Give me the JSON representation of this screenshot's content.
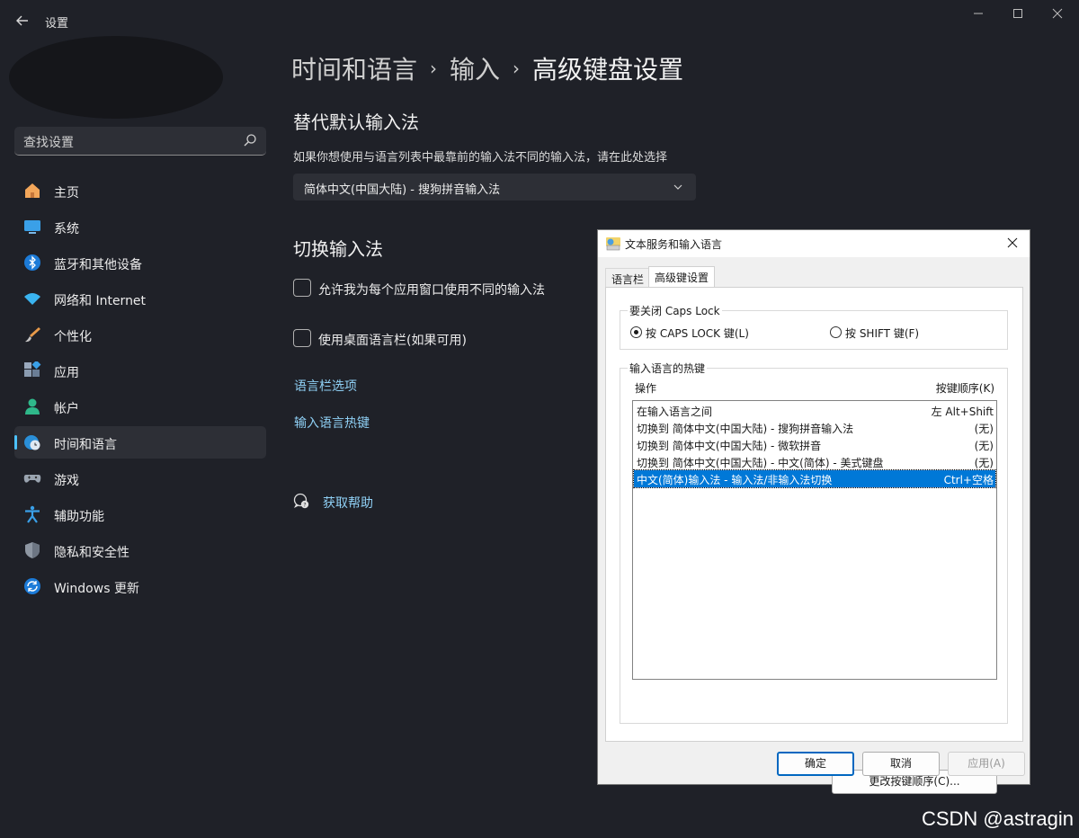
{
  "app": {
    "title": "设置",
    "back_icon": "arrow-left-icon"
  },
  "sidebar": {
    "search_placeholder": "查找设置",
    "items": [
      {
        "label": "主页",
        "icon": "home-icon",
        "active": false
      },
      {
        "label": "系统",
        "icon": "monitor-icon",
        "active": false
      },
      {
        "label": "蓝牙和其他设备",
        "icon": "bluetooth-icon",
        "active": false
      },
      {
        "label": "网络和 Internet",
        "icon": "wifi-icon",
        "active": false
      },
      {
        "label": "个性化",
        "icon": "brush-icon",
        "active": false
      },
      {
        "label": "应用",
        "icon": "apps-icon",
        "active": false
      },
      {
        "label": "帐户",
        "icon": "person-icon",
        "active": false
      },
      {
        "label": "时间和语言",
        "icon": "globe-clock-icon",
        "active": true
      },
      {
        "label": "游戏",
        "icon": "gamepad-icon",
        "active": false
      },
      {
        "label": "辅助功能",
        "icon": "accessibility-icon",
        "active": false
      },
      {
        "label": "隐私和安全性",
        "icon": "shield-icon",
        "active": false
      },
      {
        "label": "Windows 更新",
        "icon": "refresh-icon",
        "active": false
      }
    ]
  },
  "breadcrumb": {
    "part1": "时间和语言",
    "part2": "输入",
    "current": "高级键盘设置",
    "separator": "›"
  },
  "main": {
    "section1_title": "替代默认输入法",
    "section1_desc": "如果你想使用与语言列表中最靠前的输入法不同的输入法，请在此处选择",
    "dropdown_value": "简体中文(中国大陆) - 搜狗拼音输入法",
    "section2_title": "切换输入法",
    "checkbox1_label": "允许我为每个应用窗口使用不同的输入法",
    "checkbox2_label": "使用桌面语言栏(如果可用)",
    "link1": "语言栏选项",
    "link2": "输入语言热键",
    "help_link": "获取帮助"
  },
  "dialog": {
    "title": "文本服务和输入语言",
    "tabs": [
      "语言栏",
      "高级键设置"
    ],
    "active_tab": 1,
    "capslock_group": "要关闭 Caps Lock",
    "radio1": "按 CAPS LOCK 键(L)",
    "radio2": "按 SHIFT 键(F)",
    "radio_selected": 1,
    "hotkeys_group": "输入语言的热键",
    "col_action": "操作",
    "col_key": "按键顺序(K)",
    "rows": [
      {
        "action": "在输入语言之间",
        "key": "左 Alt+Shift",
        "selected": false
      },
      {
        "action": "切换到 简体中文(中国大陆) - 搜狗拼音输入法",
        "key": "(无)",
        "selected": false
      },
      {
        "action": "切换到 简体中文(中国大陆) - 微软拼音",
        "key": "(无)",
        "selected": false
      },
      {
        "action": "切换到 简体中文(中国大陆) - 中文(简体) - 美式键盘",
        "key": "(无)",
        "selected": false
      },
      {
        "action": "中文(简体)输入法 - 输入法/非输入法切换",
        "key": "Ctrl+空格",
        "selected": true
      }
    ],
    "change_button": "更改按键顺序(C)...",
    "ok": "确定",
    "cancel": "取消",
    "apply": "应用(A)"
  },
  "watermark": "CSDN @astragin",
  "colors": {
    "background": "#1f2128",
    "accent": "#4cc2ff",
    "link": "#8fd0f5",
    "selection": "#0078d7"
  }
}
